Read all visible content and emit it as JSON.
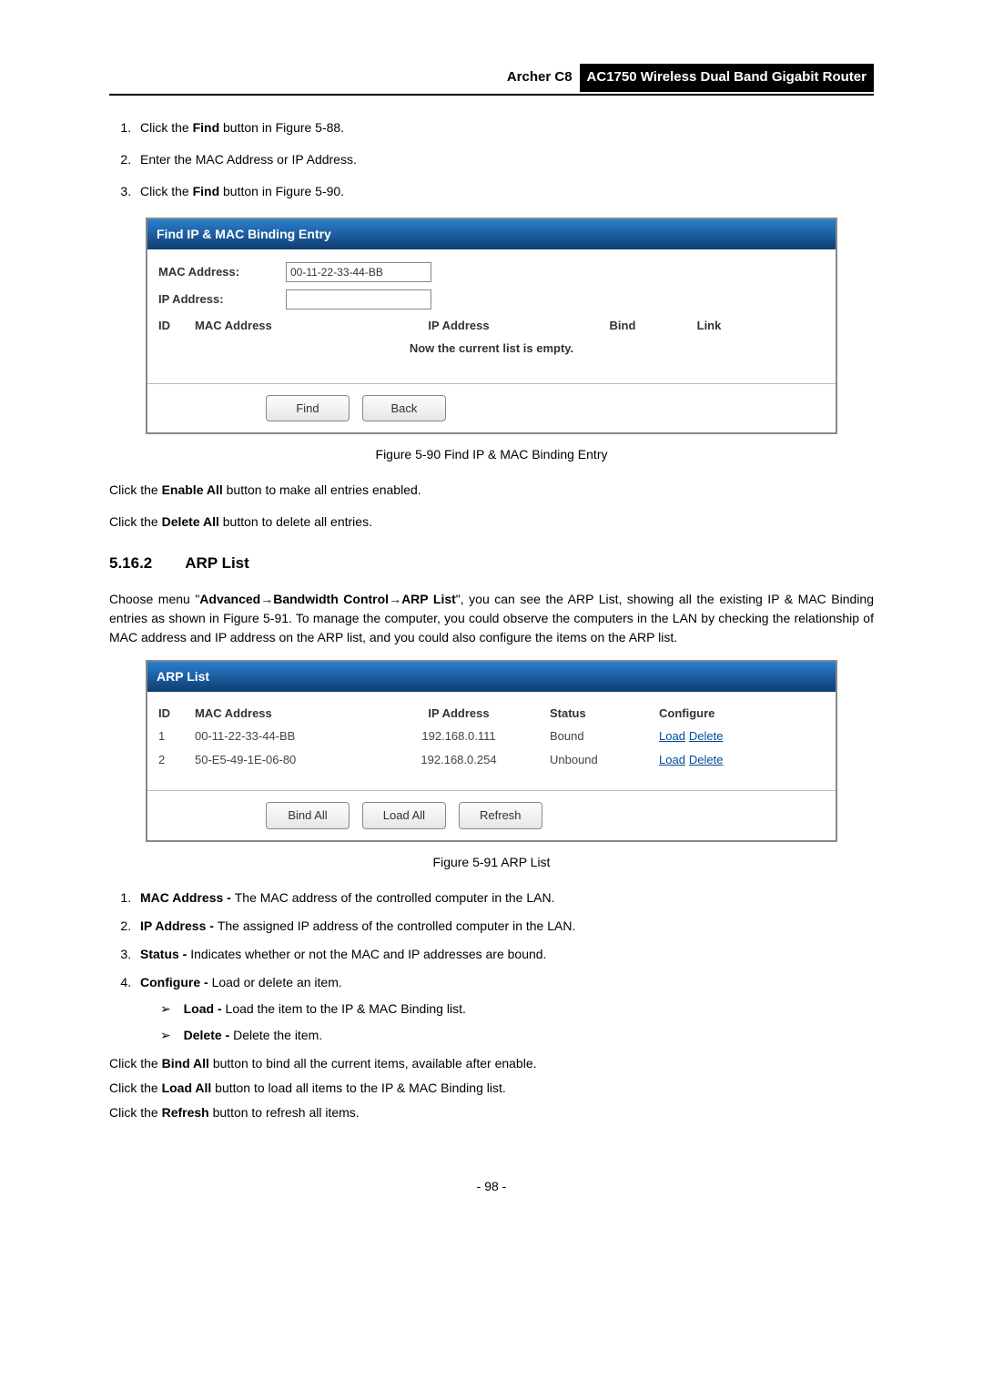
{
  "header": {
    "model": "Archer C8",
    "title": "AC1750 Wireless Dual Band Gigabit Router"
  },
  "steps_top": [
    {
      "prefix": "Click the ",
      "bold": "Find",
      "suffix": " button in Figure 5-88."
    },
    {
      "prefix": "Enter the MAC Address or IP Address.",
      "bold": "",
      "suffix": ""
    },
    {
      "prefix": "Click the ",
      "bold": "Find",
      "suffix": " button in Figure 5-90."
    }
  ],
  "find_panel": {
    "title": "Find IP & MAC Binding Entry",
    "mac_label": "MAC Address:",
    "mac_value": "00-11-22-33-44-BB",
    "ip_label": "IP Address:",
    "ip_value": "",
    "cols": {
      "id": "ID",
      "mac": "MAC Address",
      "ip": "IP Address",
      "bind": "Bind",
      "link": "Link"
    },
    "empty_msg": "Now the current list is empty.",
    "find_btn": "Find",
    "back_btn": "Back"
  },
  "fig590_caption": "Figure 5-90 Find IP & MAC Binding Entry",
  "enable_all_line": {
    "pre": "Click the ",
    "bold": "Enable All",
    "post": " button to make all entries enabled."
  },
  "delete_all_line": {
    "pre": "Click the ",
    "bold": "Delete All",
    "post": " button to delete all entries."
  },
  "section": {
    "num": "5.16.2",
    "title": "ARP List"
  },
  "arp_intro": {
    "pre": "Choose menu \"",
    "b1": "Advanced",
    "arrow1": "→",
    "b2": "Bandwidth Control",
    "arrow2": "→",
    "b3": "ARP List",
    "post": "\", you can see the ARP List, showing all the existing IP & MAC Binding entries as shown in Figure 5-91. To manage the computer, you could observe the computers in the LAN by checking the relationship of MAC address and IP address on the ARP list, and you could also configure the items on the ARP list."
  },
  "arp_panel": {
    "title": "ARP List",
    "cols": {
      "id": "ID",
      "mac": "MAC Address",
      "ip": "IP Address",
      "status": "Status",
      "conf": "Configure"
    },
    "rows": [
      {
        "id": "1",
        "mac": "00-11-22-33-44-BB",
        "ip": "192.168.0.111",
        "status": "Bound",
        "load": "Load",
        "delete": "Delete"
      },
      {
        "id": "2",
        "mac": "50-E5-49-1E-06-80",
        "ip": "192.168.0.254",
        "status": "Unbound",
        "load": "Load",
        "delete": "Delete"
      }
    ],
    "bind_all_btn": "Bind All",
    "load_all_btn": "Load All",
    "refresh_btn": "Refresh"
  },
  "fig591_caption": "Figure 5-91 ARP List",
  "defs": [
    {
      "term": "MAC Address",
      "sep": " - ",
      "desc": "The MAC address of the controlled computer in the LAN."
    },
    {
      "term": "IP Address",
      "sep": " - ",
      "desc": "The assigned IP address of the controlled computer in the LAN."
    },
    {
      "term": "Status",
      "sep": " - ",
      "desc": "Indicates whether or not the MAC and IP addresses are bound."
    },
    {
      "term": "Configure",
      "sep": " - ",
      "desc": "Load or delete an item."
    }
  ],
  "sub_defs": [
    {
      "term": "Load",
      "sep": " - ",
      "desc": "Load the item to the IP & MAC Binding list."
    },
    {
      "term": "Delete",
      "sep": " - ",
      "desc": "Delete the item."
    }
  ],
  "bind_all_line": {
    "pre": "Click the ",
    "bold": "Bind All",
    "post": " button to bind all the current items, available after enable."
  },
  "load_all_line": {
    "pre": "Click the ",
    "bold": "Load All",
    "post": " button to load all items to the IP & MAC Binding list."
  },
  "refresh_line": {
    "pre": "Click the ",
    "bold": "Refresh",
    "post": " button to refresh all items."
  },
  "page_number": "- 98 -"
}
